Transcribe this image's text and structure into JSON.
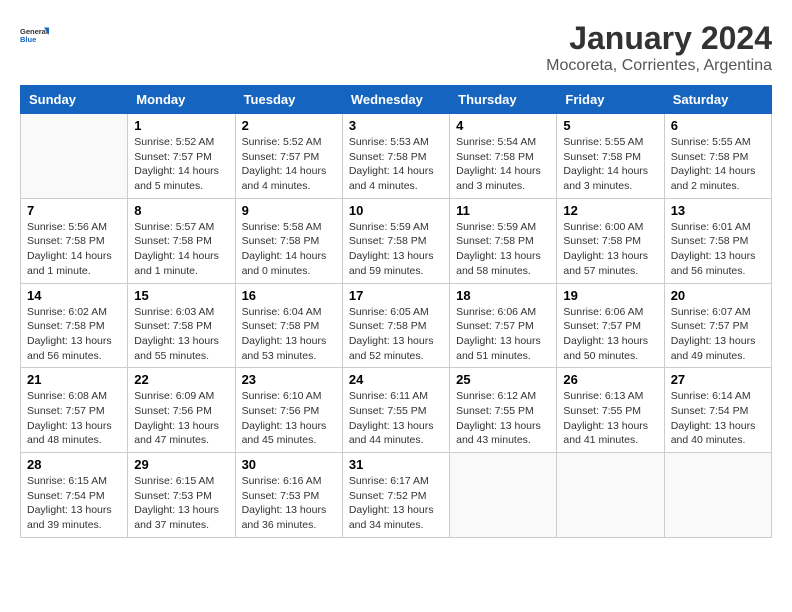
{
  "header": {
    "logo_general": "General",
    "logo_blue": "Blue",
    "title": "January 2024",
    "subtitle": "Mocoreta, Corrientes, Argentina"
  },
  "days_of_week": [
    "Sunday",
    "Monday",
    "Tuesday",
    "Wednesday",
    "Thursday",
    "Friday",
    "Saturday"
  ],
  "weeks": [
    [
      {
        "day": "",
        "info": ""
      },
      {
        "day": "1",
        "info": "Sunrise: 5:52 AM\nSunset: 7:57 PM\nDaylight: 14 hours\nand 5 minutes."
      },
      {
        "day": "2",
        "info": "Sunrise: 5:52 AM\nSunset: 7:57 PM\nDaylight: 14 hours\nand 4 minutes."
      },
      {
        "day": "3",
        "info": "Sunrise: 5:53 AM\nSunset: 7:58 PM\nDaylight: 14 hours\nand 4 minutes."
      },
      {
        "day": "4",
        "info": "Sunrise: 5:54 AM\nSunset: 7:58 PM\nDaylight: 14 hours\nand 3 minutes."
      },
      {
        "day": "5",
        "info": "Sunrise: 5:55 AM\nSunset: 7:58 PM\nDaylight: 14 hours\nand 3 minutes."
      },
      {
        "day": "6",
        "info": "Sunrise: 5:55 AM\nSunset: 7:58 PM\nDaylight: 14 hours\nand 2 minutes."
      }
    ],
    [
      {
        "day": "7",
        "info": "Sunrise: 5:56 AM\nSunset: 7:58 PM\nDaylight: 14 hours\nand 1 minute."
      },
      {
        "day": "8",
        "info": "Sunrise: 5:57 AM\nSunset: 7:58 PM\nDaylight: 14 hours\nand 1 minute."
      },
      {
        "day": "9",
        "info": "Sunrise: 5:58 AM\nSunset: 7:58 PM\nDaylight: 14 hours\nand 0 minutes."
      },
      {
        "day": "10",
        "info": "Sunrise: 5:59 AM\nSunset: 7:58 PM\nDaylight: 13 hours\nand 59 minutes."
      },
      {
        "day": "11",
        "info": "Sunrise: 5:59 AM\nSunset: 7:58 PM\nDaylight: 13 hours\nand 58 minutes."
      },
      {
        "day": "12",
        "info": "Sunrise: 6:00 AM\nSunset: 7:58 PM\nDaylight: 13 hours\nand 57 minutes."
      },
      {
        "day": "13",
        "info": "Sunrise: 6:01 AM\nSunset: 7:58 PM\nDaylight: 13 hours\nand 56 minutes."
      }
    ],
    [
      {
        "day": "14",
        "info": "Sunrise: 6:02 AM\nSunset: 7:58 PM\nDaylight: 13 hours\nand 56 minutes."
      },
      {
        "day": "15",
        "info": "Sunrise: 6:03 AM\nSunset: 7:58 PM\nDaylight: 13 hours\nand 55 minutes."
      },
      {
        "day": "16",
        "info": "Sunrise: 6:04 AM\nSunset: 7:58 PM\nDaylight: 13 hours\nand 53 minutes."
      },
      {
        "day": "17",
        "info": "Sunrise: 6:05 AM\nSunset: 7:58 PM\nDaylight: 13 hours\nand 52 minutes."
      },
      {
        "day": "18",
        "info": "Sunrise: 6:06 AM\nSunset: 7:57 PM\nDaylight: 13 hours\nand 51 minutes."
      },
      {
        "day": "19",
        "info": "Sunrise: 6:06 AM\nSunset: 7:57 PM\nDaylight: 13 hours\nand 50 minutes."
      },
      {
        "day": "20",
        "info": "Sunrise: 6:07 AM\nSunset: 7:57 PM\nDaylight: 13 hours\nand 49 minutes."
      }
    ],
    [
      {
        "day": "21",
        "info": "Sunrise: 6:08 AM\nSunset: 7:57 PM\nDaylight: 13 hours\nand 48 minutes."
      },
      {
        "day": "22",
        "info": "Sunrise: 6:09 AM\nSunset: 7:56 PM\nDaylight: 13 hours\nand 47 minutes."
      },
      {
        "day": "23",
        "info": "Sunrise: 6:10 AM\nSunset: 7:56 PM\nDaylight: 13 hours\nand 45 minutes."
      },
      {
        "day": "24",
        "info": "Sunrise: 6:11 AM\nSunset: 7:55 PM\nDaylight: 13 hours\nand 44 minutes."
      },
      {
        "day": "25",
        "info": "Sunrise: 6:12 AM\nSunset: 7:55 PM\nDaylight: 13 hours\nand 43 minutes."
      },
      {
        "day": "26",
        "info": "Sunrise: 6:13 AM\nSunset: 7:55 PM\nDaylight: 13 hours\nand 41 minutes."
      },
      {
        "day": "27",
        "info": "Sunrise: 6:14 AM\nSunset: 7:54 PM\nDaylight: 13 hours\nand 40 minutes."
      }
    ],
    [
      {
        "day": "28",
        "info": "Sunrise: 6:15 AM\nSunset: 7:54 PM\nDaylight: 13 hours\nand 39 minutes."
      },
      {
        "day": "29",
        "info": "Sunrise: 6:15 AM\nSunset: 7:53 PM\nDaylight: 13 hours\nand 37 minutes."
      },
      {
        "day": "30",
        "info": "Sunrise: 6:16 AM\nSunset: 7:53 PM\nDaylight: 13 hours\nand 36 minutes."
      },
      {
        "day": "31",
        "info": "Sunrise: 6:17 AM\nSunset: 7:52 PM\nDaylight: 13 hours\nand 34 minutes."
      },
      {
        "day": "",
        "info": ""
      },
      {
        "day": "",
        "info": ""
      },
      {
        "day": "",
        "info": ""
      }
    ]
  ]
}
